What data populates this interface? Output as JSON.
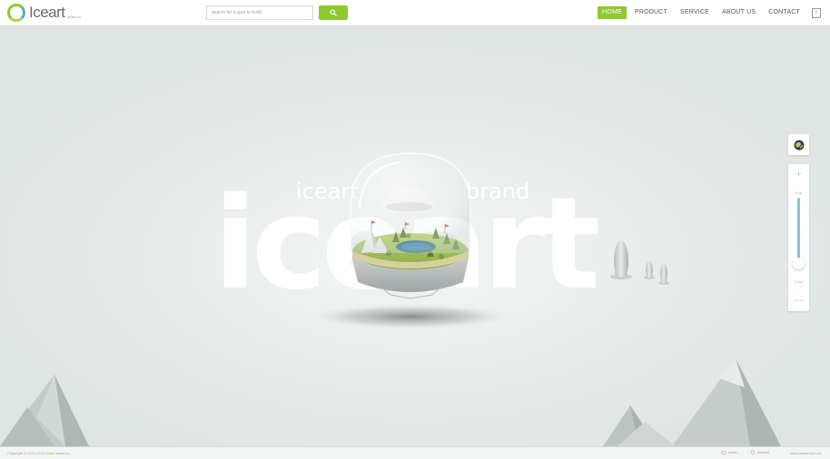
{
  "brand": {
    "name": "Iceart",
    "sub": "Iceart.cn",
    "wordmark_big": "iceart",
    "wordmark_small_left": "iceart",
    "wordmark_small_right": "brand"
  },
  "search": {
    "placeholder": "search for a spot to build",
    "button_icon": "search-icon"
  },
  "nav": {
    "items": [
      {
        "label": "HOME",
        "active": true
      },
      {
        "label": "PRODUCT",
        "active": false
      },
      {
        "label": "SERVICE",
        "active": false
      },
      {
        "label": "ABOUT US",
        "active": false
      },
      {
        "label": "CONTACT",
        "active": false
      }
    ],
    "info_icon": "i"
  },
  "zoom": {
    "plus": "+",
    "minus": "—",
    "top_label": "Fog",
    "bottom_label": "Color",
    "level": 0.9
  },
  "footer": {
    "copyright_prefix": "Copyright © 2010-2013",
    "copyright_highlight": "Iceart",
    "copyright_suffix": "iceart.cn",
    "share1": "weibo",
    "share2": "tencent",
    "url": "www.iceart.com.cn"
  },
  "colors": {
    "accent": "#8dc92f",
    "background": "#dfe5e3",
    "slider": "#88c3df"
  }
}
